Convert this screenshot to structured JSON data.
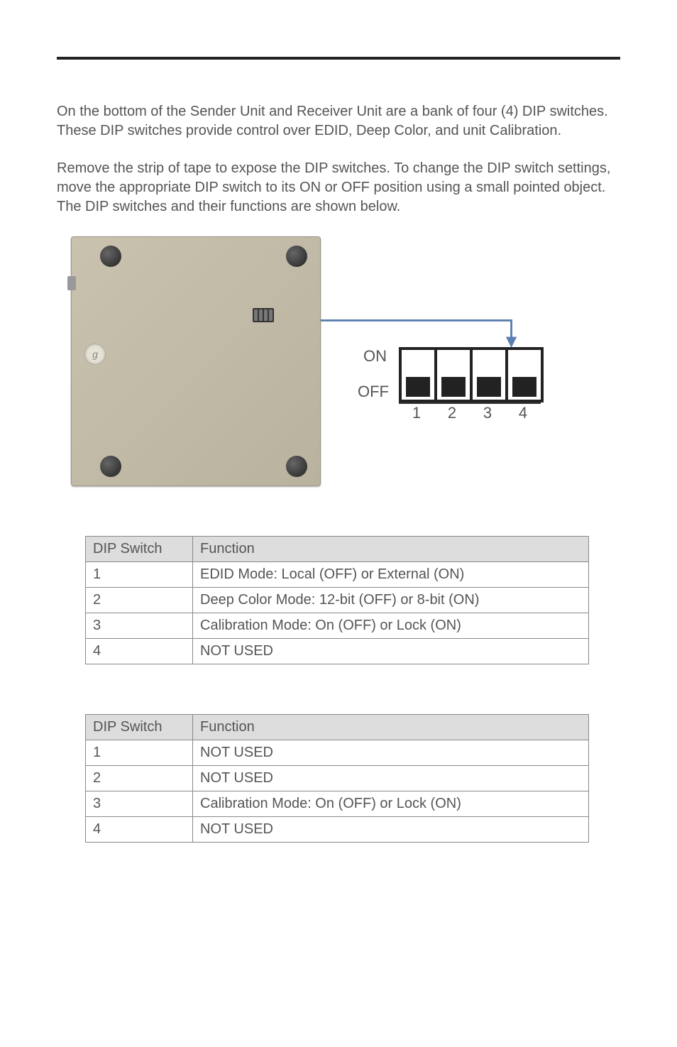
{
  "paragraphs": {
    "p1": "On the bottom of the Sender Unit and Receiver Unit are a bank of four (4) DIP switches.  These DIP switches provide control over EDID, Deep Color, and unit Calibration.",
    "p2": "Remove the strip of tape to expose the DIP switches.  To change the DIP switch settings, move the appropriate DIP switch to its ON or OFF position using a small pointed object.  The DIP switches and their functions are shown below."
  },
  "dip_diagram": {
    "on_label": "ON",
    "off_label": "OFF",
    "numbers": [
      "1",
      "2",
      "3",
      "4"
    ],
    "states": [
      "off",
      "off",
      "off",
      "off"
    ]
  },
  "tables": {
    "header_switch": "DIP Switch",
    "header_function": "Function",
    "table1": [
      {
        "sw": "1",
        "fn": "EDID Mode: Local (OFF) or External (ON)"
      },
      {
        "sw": "2",
        "fn": "Deep Color Mode: 12-bit (OFF) or 8-bit (ON)"
      },
      {
        "sw": "3",
        "fn": "Calibration Mode: On (OFF) or Lock (ON)"
      },
      {
        "sw": "4",
        "fn": "NOT USED"
      }
    ],
    "table2": [
      {
        "sw": "1",
        "fn": "NOT USED"
      },
      {
        "sw": "2",
        "fn": "NOT USED"
      },
      {
        "sw": "3",
        "fn": "Calibration Mode: On (OFF) or Lock (ON)"
      },
      {
        "sw": "4",
        "fn": "NOT USED"
      }
    ]
  }
}
